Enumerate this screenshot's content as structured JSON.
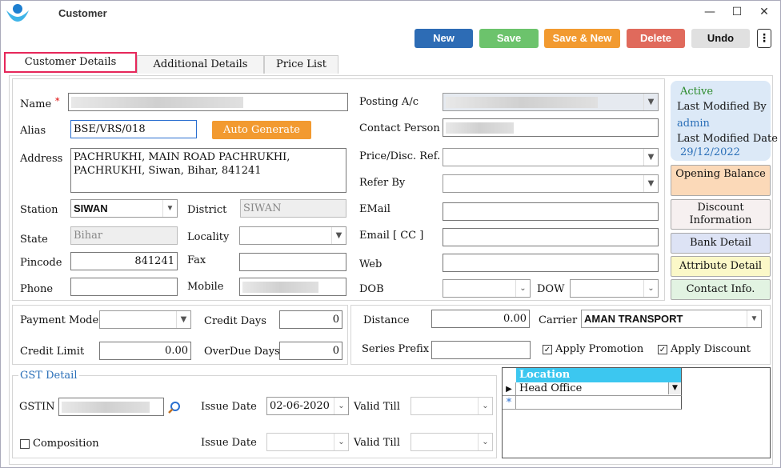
{
  "window": {
    "title": "Customer",
    "logo_icon": "logo-icon",
    "minimize": "—",
    "maximize": "☐",
    "close": "✕"
  },
  "toolbar": {
    "new": "New",
    "save": "Save",
    "save_new": "Save & New",
    "delete": "Delete",
    "undo": "Undo",
    "more": "⋮",
    "colors": {
      "new": "#2d6cb5",
      "save": "#6cc36c",
      "save_new": "#f29a30",
      "delete": "#e06a5c",
      "undo": "#e0e0e0"
    }
  },
  "tabs": [
    "Customer Details",
    "Additional Details",
    "Price List"
  ],
  "form": {
    "name_label": "Name",
    "required_mark": "*",
    "name_value": "",
    "alias_label": "Alias",
    "alias_value": "BSE/VRS/018",
    "auto_generate": "Auto Generate",
    "address_label": "Address",
    "address_value": "PACHRUKHI, MAIN ROAD PACHRUKHI, PACHRUKHI, Siwan, Bihar, 841241",
    "station_label": "Station",
    "station_value": "SIWAN",
    "district_label": "District",
    "district_value": "SIWAN",
    "state_label": "State",
    "state_value": "Bihar",
    "locality_label": "Locality",
    "locality_value": "",
    "pincode_label": "Pincode",
    "pincode_value": "841241",
    "fax_label": "Fax",
    "fax_value": "",
    "phone_label": "Phone",
    "phone_value": "",
    "mobile_label": "Mobile",
    "mobile_value": "",
    "posting_label": "Posting A/c",
    "contact_person_label": "Contact Person",
    "price_disc_label": "Price/Disc. Ref.",
    "refer_by_label": "Refer By",
    "email_label": "EMail",
    "email_cc_label": "Email [ CC ]",
    "web_label": "Web",
    "dob_label": "DOB",
    "dow_label": "DOW"
  },
  "status": {
    "active": "Active",
    "last_modified_by_label": "Last Modified By",
    "last_modified_by": "admin",
    "last_modified_date_label": "Last Modified Date",
    "last_modified_date": "29/12/2022"
  },
  "side_buttons": [
    {
      "label": "Opening Balance",
      "color": "#fbd9b8"
    },
    {
      "label": "Discount Information",
      "color": "#f6f0f0"
    },
    {
      "label": "Bank Detail",
      "color": "#dde3f5"
    },
    {
      "label": "Attribute Detail",
      "color": "#fbf8c8"
    },
    {
      "label": "Contact Info.",
      "color": "#e2f3e2"
    }
  ],
  "credit": {
    "payment_mode_label": "Payment Mode",
    "payment_mode_value": "",
    "credit_days_label": "Credit Days",
    "credit_days_value": "0",
    "credit_limit_label": "Credit Limit",
    "credit_limit_value": "0.00",
    "overdue_days_label": "OverDue Days",
    "overdue_days_value": "0"
  },
  "transport": {
    "distance_label": "Distance",
    "distance_value": "0.00",
    "carrier_label": "Carrier",
    "carrier_value": "AMAN TRANSPORT",
    "series_prefix_label": "Series Prefix",
    "series_prefix_value": "",
    "apply_promotion": "Apply Promotion",
    "apply_discount": "Apply Discount",
    "check_mark": "✓"
  },
  "gst": {
    "legend": "GST Detail",
    "gstin_label": "GSTIN",
    "issue_date_label": "Issue Date",
    "issue_date_value": "02-06-2020",
    "valid_till_label": "Valid Till",
    "composition_label": "Composition",
    "issue_date2_label": "Issue Date",
    "valid_till2_label": "Valid Till"
  },
  "location_grid": {
    "header": "Location",
    "rows": [
      "Head Office"
    ],
    "new_row_marker": "*",
    "current_marker": "▶"
  }
}
